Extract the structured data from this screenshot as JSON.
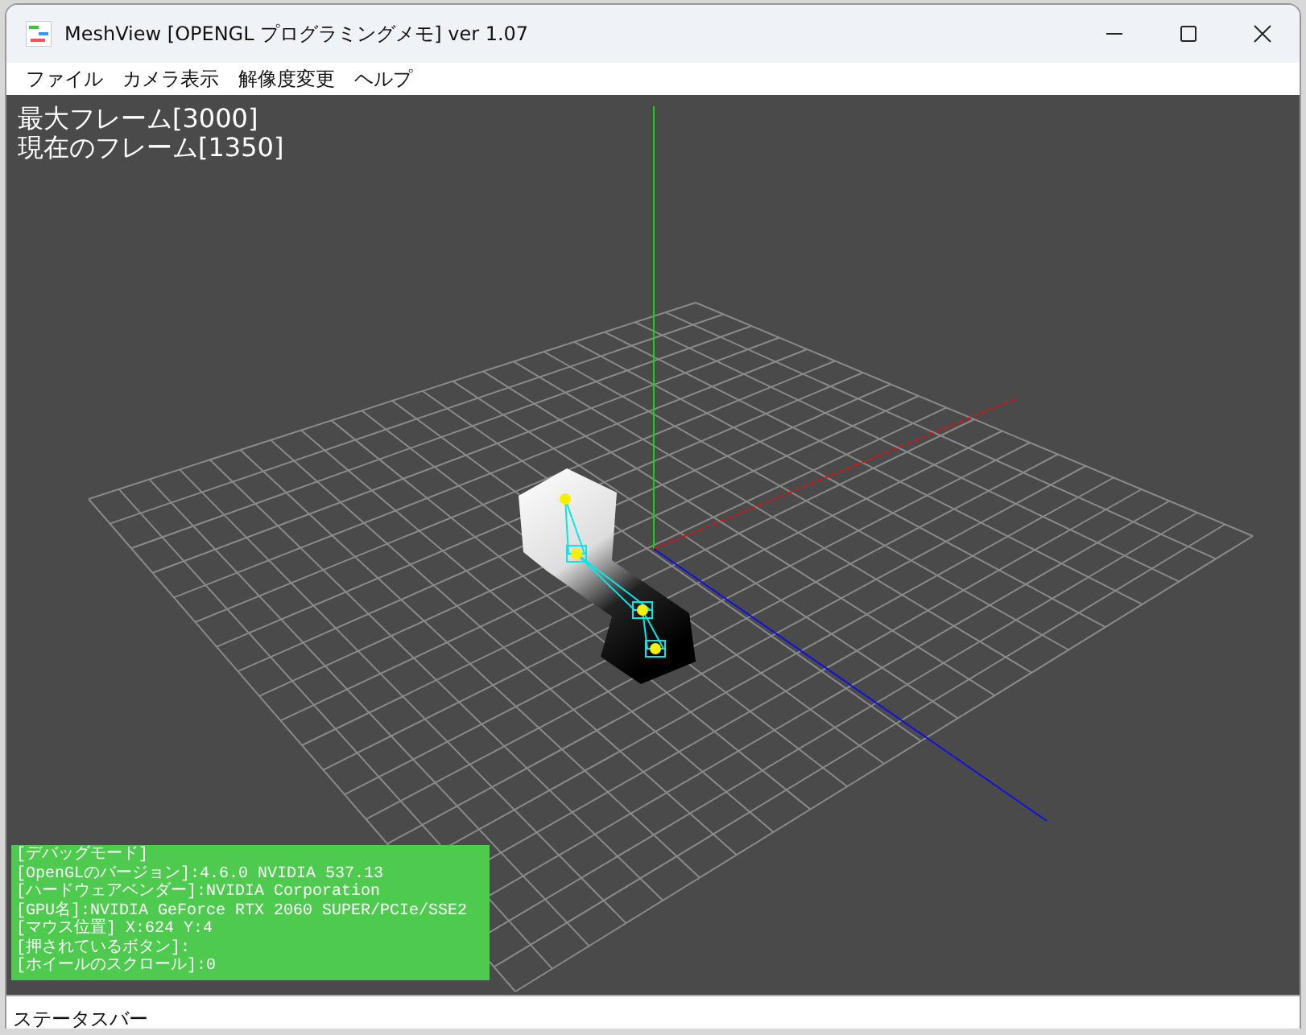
{
  "window": {
    "title": "MeshView [OPENGL プログラミングメモ] ver 1.07"
  },
  "menu": [
    "ファイル",
    "カメラ表示",
    "解像度変更",
    "ヘルプ"
  ],
  "viewport": {
    "overlay": [
      "最大フレーム[3000]",
      "現在のフレーム[1350]"
    ],
    "debug_panel": [
      "[デバッグモード]",
      "[OpenGLのバージョン]:4.6.0 NVIDIA 537.13",
      "[ハードウェアベンダー]:NVIDIA Corporation",
      "[GPU名]:NVIDIA GeForce RTX 2060 SUPER/PCIe/SSE2",
      "[マウス位置] X:624 Y:4",
      "[押されているボタン]:",
      "[ホイールのスクロール]:0"
    ]
  },
  "status_bar": "ステータスバー"
}
